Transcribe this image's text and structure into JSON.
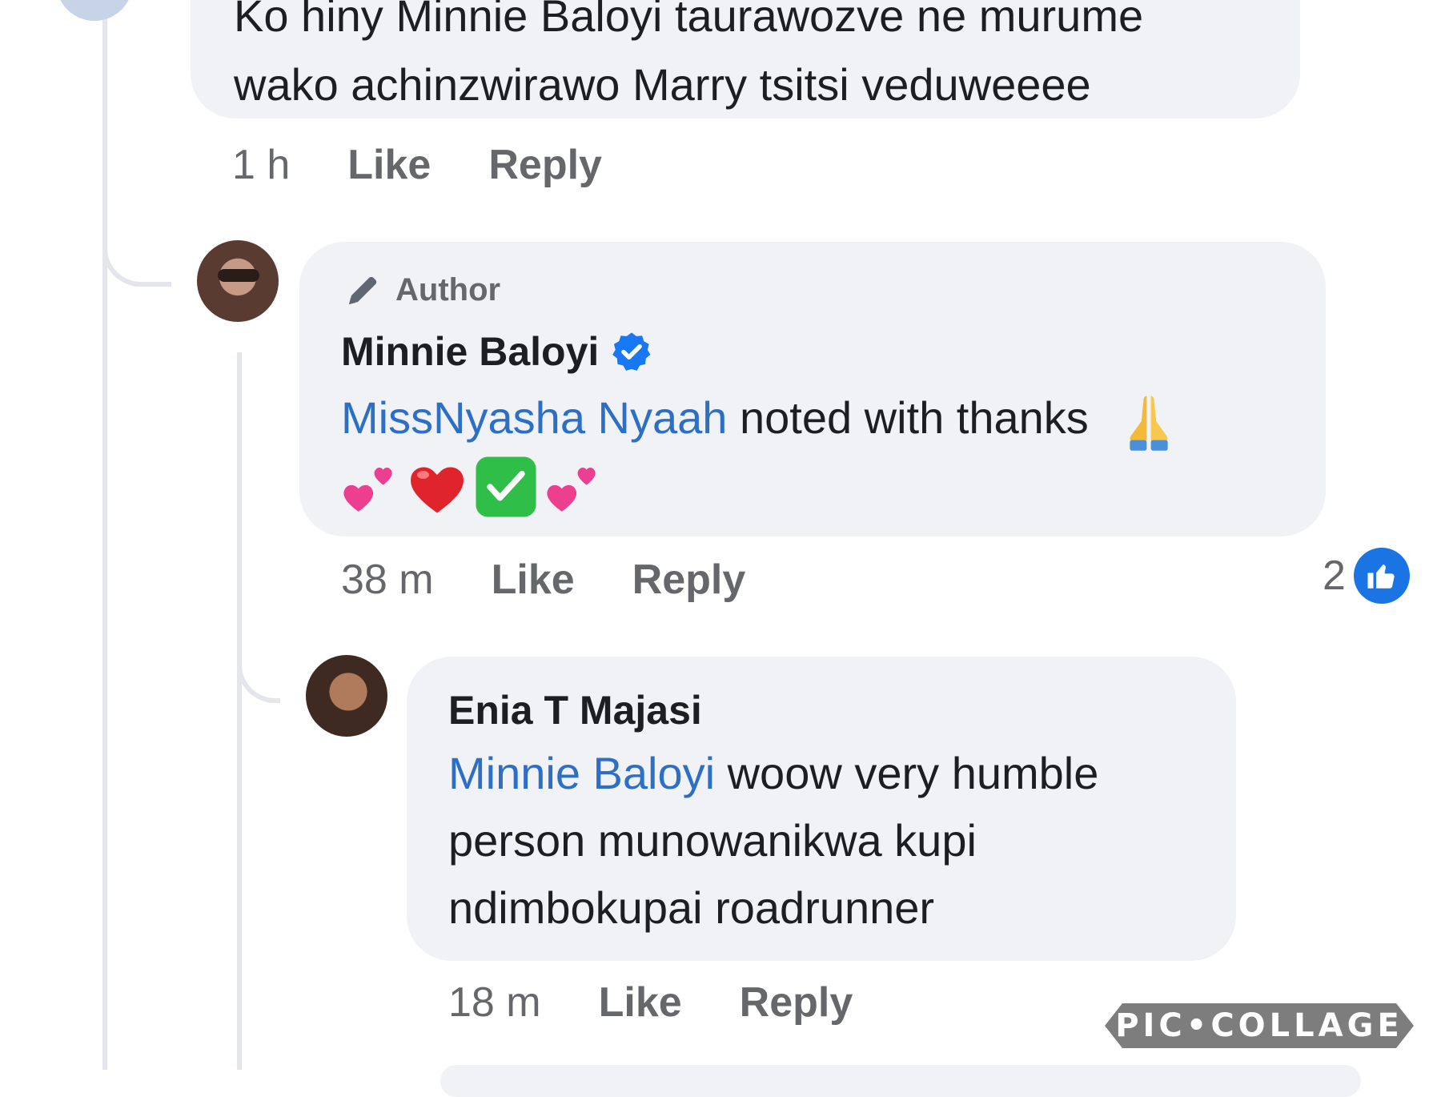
{
  "top_comment": {
    "line1_partial": "Ko hiny Minnie Baloyi taurawozve ne murume",
    "line2": "wako achinzwirawo Marry tsitsi veduweeee",
    "time": "1 h",
    "like_label": "Like",
    "reply_label": "Reply"
  },
  "author_reply": {
    "badge_label": "Author",
    "name": "Minnie Baloyi",
    "verified": true,
    "mention": "MissNyasha Nyaah",
    "text": " noted with thanks",
    "emojis": [
      "folded-hands",
      "two-hearts",
      "red-heart",
      "check-mark-button",
      "two-hearts"
    ],
    "time": "38 m",
    "like_label": "Like",
    "reply_label": "Reply",
    "reaction_count": "2",
    "reaction_type": "like"
  },
  "nested_reply": {
    "name": "Enia T Majasi",
    "mention": "Minnie Baloyi",
    "text_line1": " woow very humble",
    "text_line2": "person munowanikwa kupi",
    "text_line3": "ndimbokupai roadrunner",
    "time": "18 m",
    "like_label": "Like",
    "reply_label": "Reply"
  },
  "watermark": "PIC•COLLAGE",
  "colors": {
    "bubble": "#f0f2f5",
    "mention": "#2d6fc4",
    "like_blue": "#1b74e4",
    "meta_gray": "#65676b"
  }
}
